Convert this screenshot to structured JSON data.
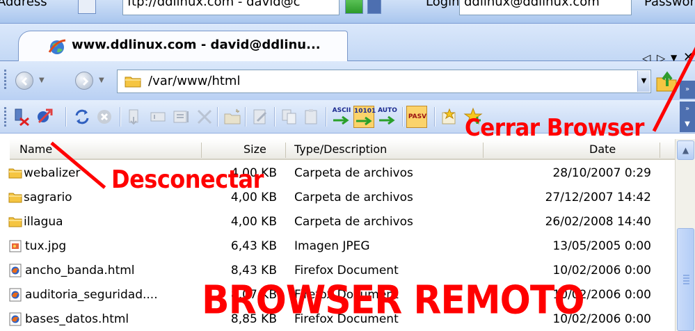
{
  "top_bar": {
    "address_label": "Address",
    "address_value": "ftp://ddlinux.com - david@c",
    "login_label": "Login",
    "login_value": "ddlinux@ddlinux.com",
    "password_label": "Password"
  },
  "tab": {
    "title": "www.ddlinux.com - david@ddlinu...",
    "controls": {
      "prev": "◁",
      "next": "▷",
      "menu": "▼",
      "close": "✕"
    }
  },
  "path_bar": {
    "path": "/var/www/html"
  },
  "list": {
    "columns": [
      "Name",
      "Size",
      "Type/Description",
      "Date"
    ],
    "rows": [
      {
        "icon": "folder-icon",
        "name": "webalizer",
        "size": "4,00 KB",
        "type": "Carpeta de archivos",
        "date": "28/10/2007 0:29"
      },
      {
        "icon": "folder-icon",
        "name": "sagrario",
        "size": "4,00 KB",
        "type": "Carpeta de archivos",
        "date": "27/12/2007 14:42"
      },
      {
        "icon": "folder-icon",
        "name": "illagua",
        "size": "4,00 KB",
        "type": "Carpeta de archivos",
        "date": "26/02/2008 14:40"
      },
      {
        "icon": "image-file-icon",
        "name": "tux.jpg",
        "size": "6,43 KB",
        "type": "Imagen JPEG",
        "date": "13/05/2005 0:00"
      },
      {
        "icon": "firefox-document-icon",
        "name": "ancho_banda.html",
        "size": "8,43 KB",
        "type": "Firefox Document",
        "date": "10/02/2006 0:00"
      },
      {
        "icon": "firefox-document-icon",
        "name": "auditoria_seguridad....",
        "size": "8,07 KB",
        "type": "Firefox Document",
        "date": "10/02/2006 0:00"
      },
      {
        "icon": "firefox-document-icon",
        "name": "bases_datos.html",
        "size": "8,85 KB",
        "type": "Firefox Document",
        "date": "10/02/2006 0:00"
      }
    ]
  },
  "annotations": {
    "cerrar": "Cerrar Browser",
    "desconectar": "Desconectar",
    "browser_remoto": "BROWSER REMOTO"
  },
  "toolbar": {
    "ascii": "ASCII",
    "binary": "10101",
    "auto": "AUTO",
    "pasv": "PASV"
  },
  "colors": {
    "annotation": "#ff0000",
    "toolbar_bg": "#c4d7f4",
    "selected_toggle": "#fbd36b"
  }
}
